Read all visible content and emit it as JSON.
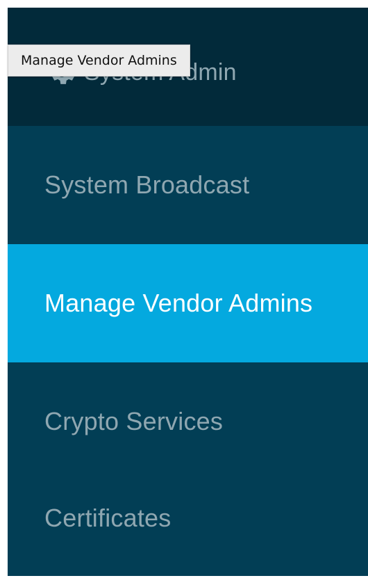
{
  "sidebar": {
    "header": {
      "label": "System Admin",
      "icon": "gear-icon"
    },
    "items": [
      {
        "label": "System Broadcast"
      },
      {
        "label": "Manage Vendor Admins",
        "active": true
      },
      {
        "label": "Crypto Services"
      },
      {
        "label": "Certificates"
      }
    ],
    "colors": {
      "background": "#023e55",
      "header_background": "#022a3a",
      "active_background": "#04a9df",
      "text": "#8fa7b1",
      "active_text": "#ffffff"
    }
  },
  "tooltip": {
    "text": "Manage Vendor Admins"
  }
}
